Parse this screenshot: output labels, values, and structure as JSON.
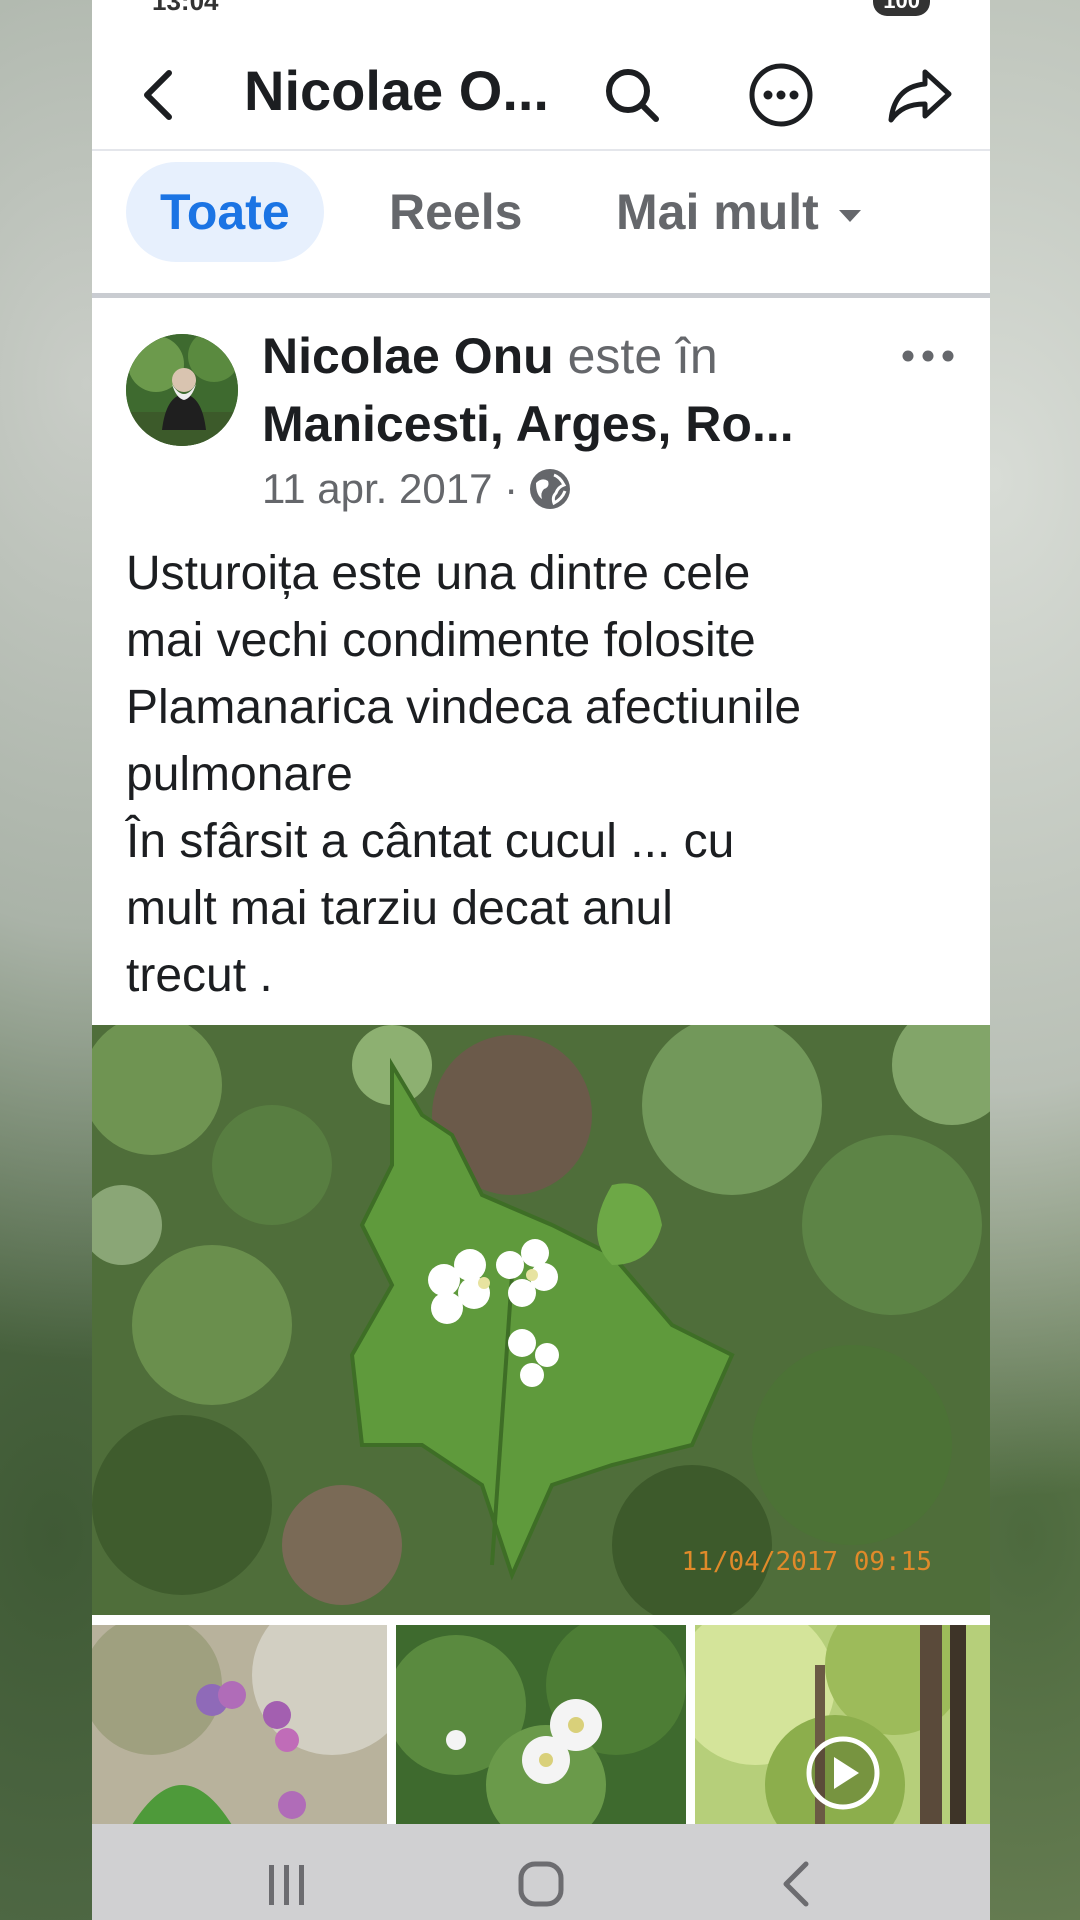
{
  "status_bar": {
    "time": "13:04",
    "battery": "100"
  },
  "header": {
    "title": "Nicolae O...",
    "back_icon": "back-arrow-icon",
    "search_icon": "search-icon",
    "more_icon": "more-icon",
    "share_icon": "share-icon"
  },
  "tabs": [
    {
      "label": "Toate",
      "active": true
    },
    {
      "label": "Reels",
      "active": false
    },
    {
      "label": "Mai mult",
      "active": false
    }
  ],
  "post": {
    "author": "Nicolae Onu",
    "verb": " este în",
    "location": "Manicesti, Arges, Ro...",
    "date": "11 apr. 2017 ·",
    "text": "Usturoița este una dintre cele\nmai vechi condimente folosite\nPlamanarica vindeca afectiunile\npulmonare\nÎn sfârsit a cântat   cucul  ... cu\nmult mai tarziu decat  anul\ntrecut .",
    "photo_timestamp": "11/04/2017 09:15"
  },
  "colors": {
    "accent": "#1b74e4",
    "tab_active_bg": "#e7f0fd",
    "muted": "#65676b"
  }
}
